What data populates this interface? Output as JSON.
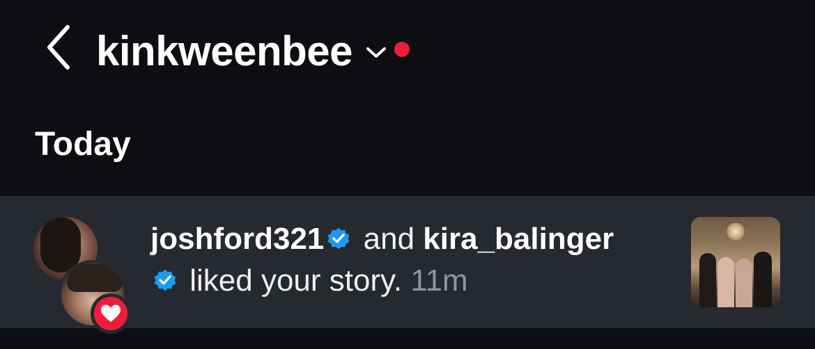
{
  "header": {
    "account_name": "kinkweenbee",
    "back_icon": "chevron-left-icon",
    "dropdown_icon": "chevron-down-icon",
    "unread_dot_color": "#ee1d3b"
  },
  "section": {
    "title": "Today"
  },
  "notification": {
    "user1": "joshford321",
    "user1_verified": true,
    "connector": "and",
    "user2": "kira_balinger",
    "user2_verified": true,
    "action": "liked your story.",
    "time": "11m",
    "badge_icon": "heart-icon",
    "badge_color": "#ee1d3b",
    "verified_color": "#1d9bf0"
  },
  "colors": {
    "background": "#0c0e12",
    "row_highlight": "#26292f",
    "text": "#ffffff",
    "muted": "#8f949c"
  }
}
